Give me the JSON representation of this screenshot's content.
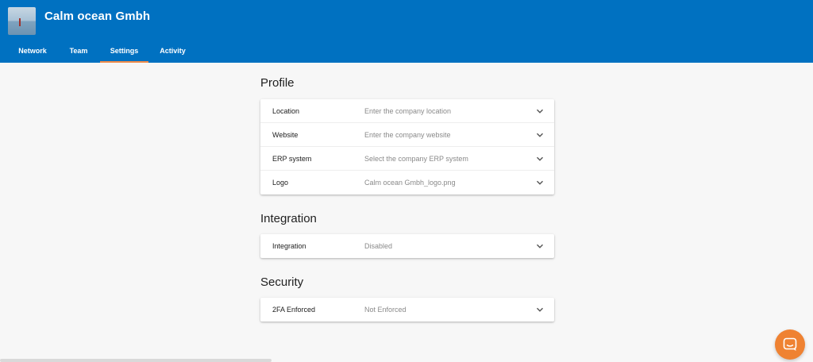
{
  "header": {
    "company_name": "Calm ocean Gmbh",
    "logo_icon": "company-logo-image",
    "background": "#0071c1",
    "tabs": [
      {
        "label": "Network",
        "active": false
      },
      {
        "label": "Team",
        "active": false
      },
      {
        "label": "Settings",
        "active": true
      },
      {
        "label": "Activity",
        "active": false
      }
    ],
    "active_tab_underline": "#f08c4a"
  },
  "sections": {
    "profile": {
      "title": "Profile",
      "rows": [
        {
          "label": "Location",
          "value": "Enter the company location",
          "icon": "chevron-down-icon"
        },
        {
          "label": "Website",
          "value": "Enter the company website",
          "icon": "chevron-down-icon"
        },
        {
          "label": "ERP system",
          "value": "Select the company ERP system",
          "icon": "chevron-down-icon"
        },
        {
          "label": "Logo",
          "value": "Calm ocean Gmbh_logo.png",
          "icon": "chevron-down-icon"
        }
      ]
    },
    "integration": {
      "title": "Integration",
      "rows": [
        {
          "label": "Integration",
          "value": "Disabled",
          "icon": "chevron-down-icon"
        }
      ]
    },
    "security": {
      "title": "Security",
      "rows": [
        {
          "label": "2FA Enforced",
          "value": "Not Enforced",
          "icon": "chevron-down-icon"
        }
      ]
    }
  },
  "chat": {
    "icon": "chat-bubble-icon",
    "color": "#ef8232"
  }
}
